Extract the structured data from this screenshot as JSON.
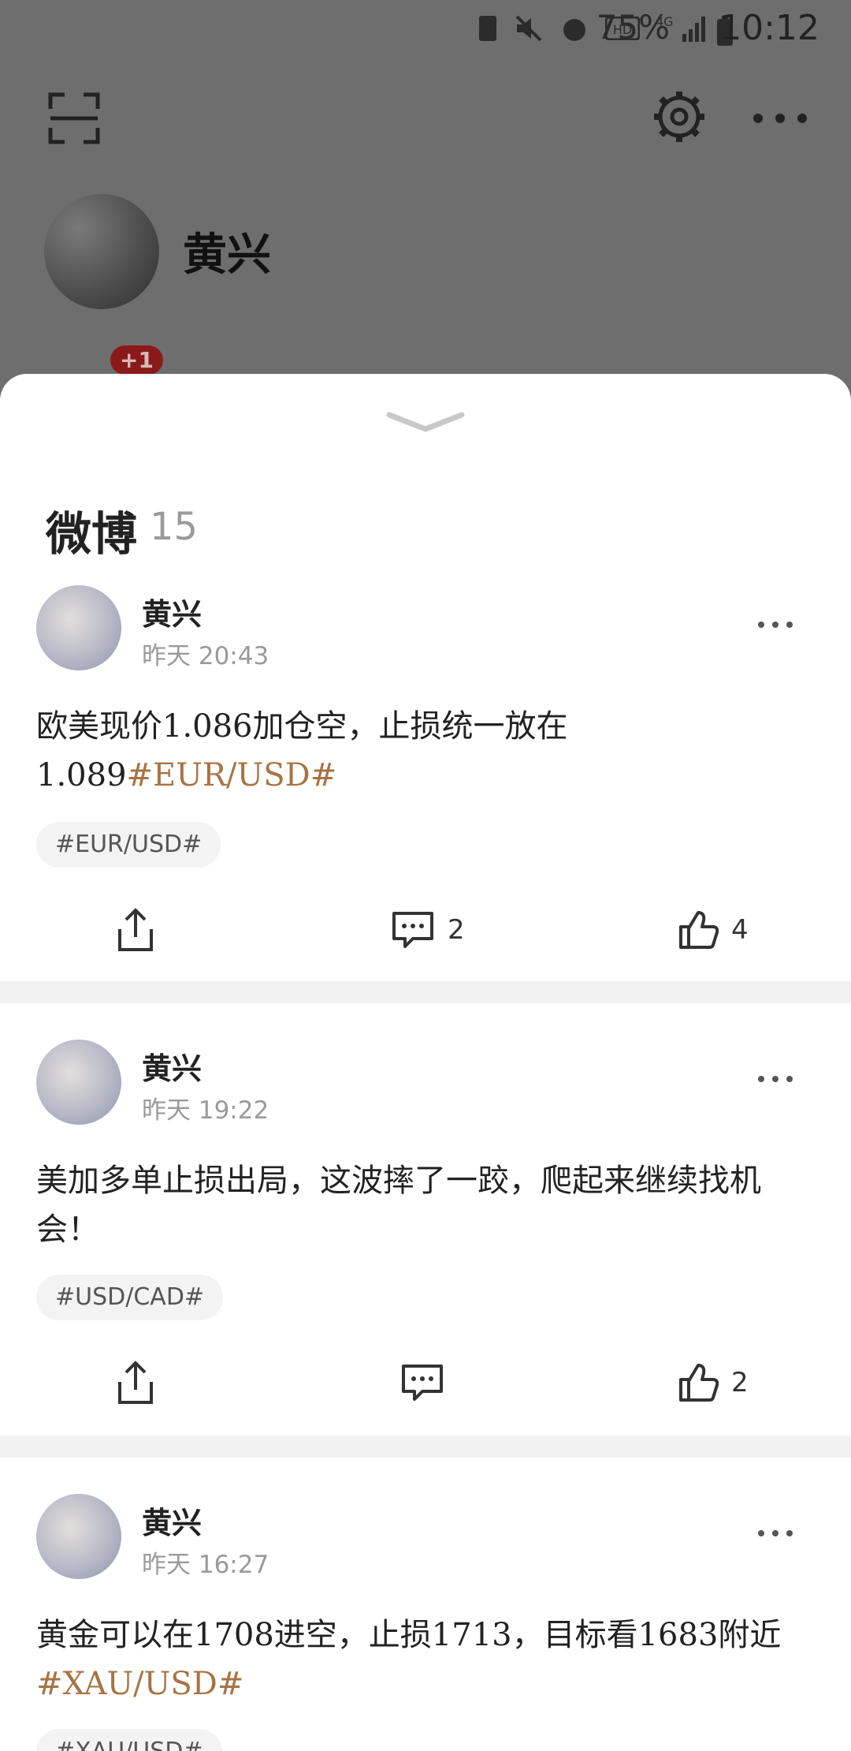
{
  "status_bar": {
    "battery_percent": "75%",
    "time": "10:12"
  },
  "profile": {
    "name": "黄兴",
    "badge": "+1"
  },
  "sheet": {
    "title": "微博",
    "count": "15",
    "posts": [
      {
        "author": "黄兴",
        "time": "昨天 20:43",
        "text_plain": "欧美现价1.086加仓空，止损统一放在1.089",
        "text_hashtag": "#EUR/USD#",
        "tag": "#EUR/USD#",
        "comments": "2",
        "likes": "4"
      },
      {
        "author": "黄兴",
        "time": "昨天 19:22",
        "text_plain": "美加多单止损出局，这波摔了一跤，爬起来继续找机会！",
        "text_hashtag": "",
        "tag": "#USD/CAD#",
        "comments": "",
        "likes": "2"
      },
      {
        "author": "黄兴",
        "time": "昨天 16:27",
        "text_plain": "黄金可以在1708进空，止损1713，目标看1683附近",
        "text_hashtag": "#XAU/USD#",
        "tag": "#XAU/USD#",
        "comments": "",
        "likes": ""
      }
    ]
  },
  "colors": {
    "hashtag": "#a87343",
    "overlay": "#757575",
    "separator": "#f2f2f2"
  },
  "icons": [
    "scan-icon",
    "gear-icon",
    "more-icon",
    "share-icon",
    "comment-icon",
    "like-icon",
    "chevron-down-icon"
  ]
}
